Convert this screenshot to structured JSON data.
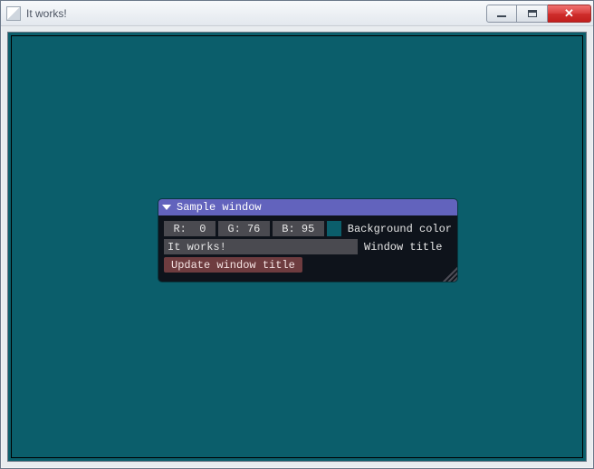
{
  "window": {
    "title": "It works!"
  },
  "panel": {
    "title": "Sample window",
    "color": {
      "r_label": "R:",
      "r_value": "0",
      "g_label": "G:",
      "g_value": "76",
      "b_label": "B:",
      "b_value": "95",
      "swatch_hex": "#0b5e6b",
      "label": "Background color"
    },
    "title_input": {
      "value": "It works!",
      "label": "Window title"
    },
    "update_button": "Update window title"
  }
}
